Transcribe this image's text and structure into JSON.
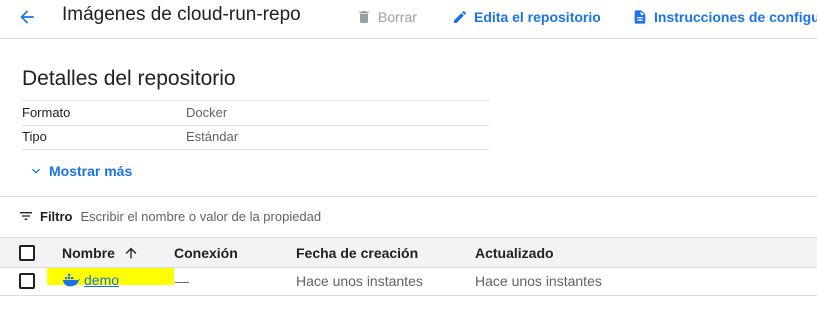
{
  "header": {
    "back_icon": "arrow-back-icon",
    "title": "Imágenes de cloud-run-repo",
    "delete_label": "Borrar",
    "edit_label": "Edita el repositorio",
    "instructions_label": "Instrucciones de configu",
    "colors": {
      "accent": "#1a73e8",
      "disabled": "#9aa0a6"
    }
  },
  "details": {
    "heading": "Detalles del repositorio",
    "rows": [
      {
        "key": "Formato",
        "value": "Docker"
      },
      {
        "key": "Tipo",
        "value": "Estándar"
      }
    ],
    "show_more": "Mostrar más"
  },
  "filter": {
    "label": "Filtro",
    "placeholder": "Escribir el nombre o valor de la propiedad"
  },
  "table": {
    "columns": [
      "Nombre",
      "Conexión",
      "Fecha de creación",
      "Actualizado"
    ],
    "sort_icon": "arrow-up-icon",
    "rows": [
      {
        "name": "demo",
        "connection": "—",
        "created": "Hace unos instantes",
        "updated": "Hace unos instantes"
      }
    ],
    "highlight_color": "#ffff00"
  }
}
